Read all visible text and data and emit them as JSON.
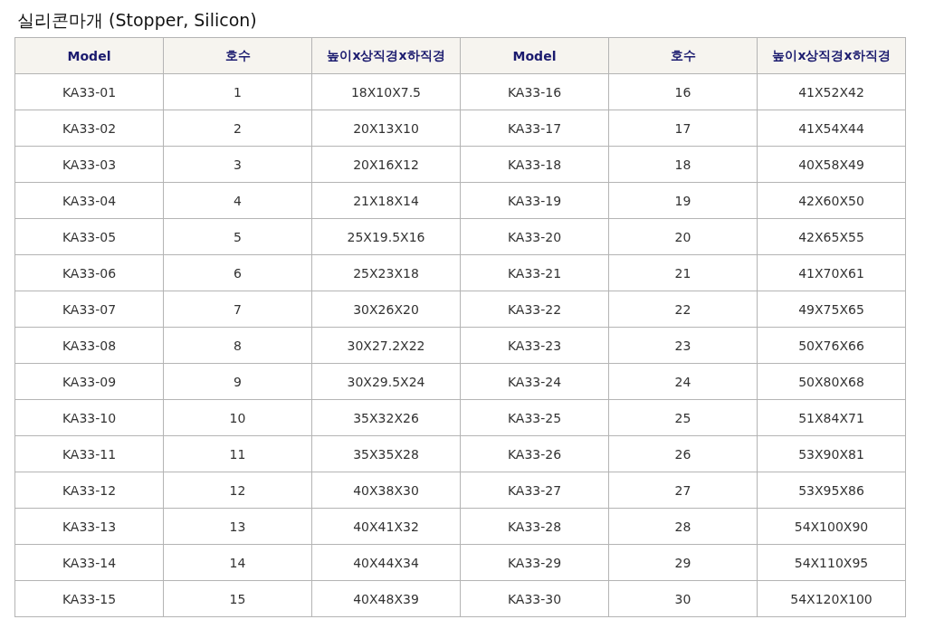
{
  "title": "실리콘마개 (Stopper, Silicon)",
  "table": {
    "columns": [
      "Model",
      "호수",
      "높이x상직경x하직경",
      "Model",
      "호수",
      "높이x상직경x하직경"
    ],
    "rows": [
      [
        "KA33-01",
        "1",
        "18X10X7.5",
        "KA33-16",
        "16",
        "41X52X42"
      ],
      [
        "KA33-02",
        "2",
        "20X13X10",
        "KA33-17",
        "17",
        "41X54X44"
      ],
      [
        "KA33-03",
        "3",
        "20X16X12",
        "KA33-18",
        "18",
        "40X58X49"
      ],
      [
        "KA33-04",
        "4",
        "21X18X14",
        "KA33-19",
        "19",
        "42X60X50"
      ],
      [
        "KA33-05",
        "5",
        "25X19.5X16",
        "KA33-20",
        "20",
        "42X65X55"
      ],
      [
        "KA33-06",
        "6",
        "25X23X18",
        "KA33-21",
        "21",
        "41X70X61"
      ],
      [
        "KA33-07",
        "7",
        "30X26X20",
        "KA33-22",
        "22",
        "49X75X65"
      ],
      [
        "KA33-08",
        "8",
        "30X27.2X22",
        "KA33-23",
        "23",
        "50X76X66"
      ],
      [
        "KA33-09",
        "9",
        "30X29.5X24",
        "KA33-24",
        "24",
        "50X80X68"
      ],
      [
        "KA33-10",
        "10",
        "35X32X26",
        "KA33-25",
        "25",
        "51X84X71"
      ],
      [
        "KA33-11",
        "11",
        "35X35X28",
        "KA33-26",
        "26",
        "53X90X81"
      ],
      [
        "KA33-12",
        "12",
        "40X38X30",
        "KA33-27",
        "27",
        "53X95X86"
      ],
      [
        "KA33-13",
        "13",
        "40X41X32",
        "KA33-28",
        "28",
        "54X100X90"
      ],
      [
        "KA33-14",
        "14",
        "40X44X34",
        "KA33-29",
        "29",
        "54X110X95"
      ],
      [
        "KA33-15",
        "15",
        "40X48X39",
        "KA33-30",
        "30",
        "54X120X100"
      ]
    ]
  }
}
